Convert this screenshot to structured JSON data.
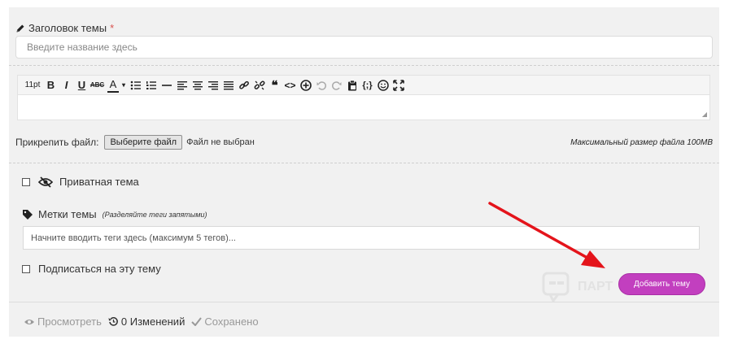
{
  "title_field": {
    "label": "Заголовок темы",
    "required_mark": "*",
    "placeholder": "Введите название здесь",
    "icon": "pencil-icon"
  },
  "toolbar": {
    "font_size": "11pt",
    "bold": "B",
    "italic": "I",
    "underline": "U",
    "strike": "ABC",
    "color": "A",
    "color_caret": "▾",
    "quote": "❝",
    "code": "<>",
    "code_block": "{;}",
    "icons": [
      "bullet-list-icon",
      "numbered-list-icon",
      "horizontal-rule-icon",
      "align-left-icon",
      "align-center-icon",
      "align-right-icon",
      "justify-icon",
      "link-icon",
      "unlink-icon",
      "quote-icon",
      "code-icon",
      "insert-icon",
      "undo-icon",
      "redo-icon",
      "paste-icon",
      "code-block-icon",
      "emoji-icon",
      "fullscreen-icon"
    ]
  },
  "attach": {
    "label": "Прикрепить файл:",
    "button": "Выберите файл",
    "status": "Файл не выбран",
    "max_size": "Максимальный размер файла 100MB"
  },
  "private_topic": {
    "label": "Приватная тема",
    "checked": false,
    "icon": "eye-slash-icon"
  },
  "tags": {
    "label": "Метки темы",
    "hint": "(Разделяйте теги запятыми)",
    "placeholder": "Начните вводить теги здесь (максимум 5 тегов)...",
    "icon": "tag-icon"
  },
  "subscribe": {
    "label": "Подписаться на эту тему",
    "checked": false
  },
  "submit_label": "Добавить тему",
  "watermark": "ПАРТ",
  "footer": {
    "preview": "Просмотреть",
    "changes": "0 Изменений",
    "saved": "Сохранено"
  },
  "colors": {
    "accent": "#c23fbf",
    "arrow": "#e4141b",
    "panel": "#f1f1f1"
  }
}
